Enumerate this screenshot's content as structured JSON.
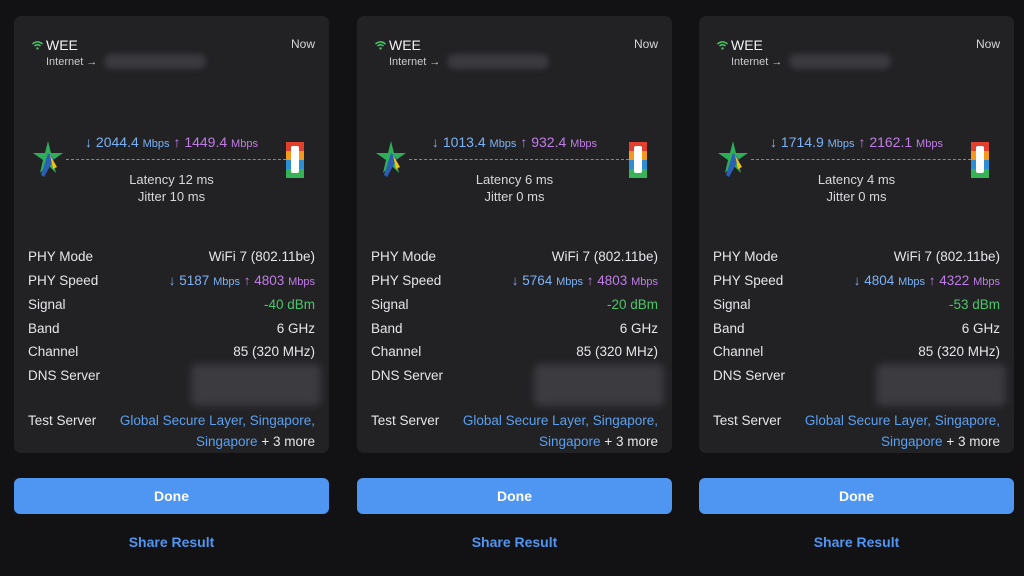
{
  "colors": {
    "background": "#121214",
    "card": "#222225",
    "download": "#7cb2f5",
    "upload": "#c17ce8",
    "signal_good": "#4cc56b",
    "accent": "#4f96f2"
  },
  "icons": [
    "wifi-icon",
    "isp-star-logo",
    "server-logo",
    "arrow-down-icon",
    "arrow-up-icon"
  ],
  "labels": {
    "phy_mode": "PHY Mode",
    "phy_speed": "PHY Speed",
    "signal": "Signal",
    "band": "Band",
    "channel": "Channel",
    "dns_server": "DNS Server",
    "test_server": "Test Server",
    "latency": "Latency",
    "jitter": "Jitter",
    "internet": "Internet →",
    "arrow_down": "↓",
    "arrow_up": "↑",
    "mbps": "Mbps",
    "ms": "ms",
    "done": "Done",
    "share": "Share Result"
  },
  "results": [
    {
      "ssid": "WEE",
      "time": "Now",
      "download": "2044.4",
      "upload": "1449.4",
      "latency": "12",
      "jitter": "10",
      "phy_mode": "WiFi 7 (802.11be)",
      "phy_down": "5187",
      "phy_up": "4803",
      "signal": "-40 dBm",
      "band": "6 GHz",
      "channel": "85 (320 MHz)",
      "server_line1": "Global Secure Layer, Singapore,",
      "server_city": "Singapore",
      "server_more": "+ 3 more"
    },
    {
      "ssid": "WEE",
      "time": "Now",
      "download": "1013.4",
      "upload": "932.4",
      "latency": "6",
      "jitter": "0",
      "phy_mode": "WiFi 7 (802.11be)",
      "phy_down": "5764",
      "phy_up": "4803",
      "signal": "-20 dBm",
      "band": "6 GHz",
      "channel": "85 (320 MHz)",
      "server_line1": "Global Secure Layer, Singapore,",
      "server_city": "Singapore",
      "server_more": "+ 3 more"
    },
    {
      "ssid": "WEE",
      "time": "Now",
      "download": "1714.9",
      "upload": "2162.1",
      "latency": "4",
      "jitter": "0",
      "phy_mode": "WiFi 7 (802.11be)",
      "phy_down": "4804",
      "phy_up": "4322",
      "signal": "-53 dBm",
      "band": "6 GHz",
      "channel": "85 (320 MHz)",
      "server_line1": "Global Secure Layer, Singapore,",
      "server_city": "Singapore",
      "server_more": "+ 3 more"
    }
  ]
}
